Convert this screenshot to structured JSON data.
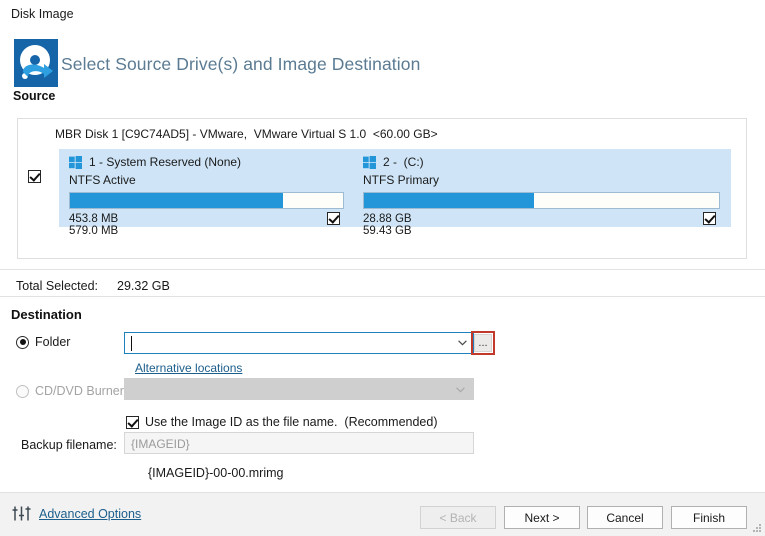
{
  "window": {
    "title": "Disk Image"
  },
  "header": {
    "title": "Select Source Drive(s) and Image Destination",
    "source_label": "Source",
    "icon": "hard-disk-backup-icon"
  },
  "source": {
    "disk_title": "MBR Disk 1 [C9C74AD5] - VMware,  VMware Virtual S 1.0  <60.00 GB>",
    "disk_selected": true,
    "partitions": [
      {
        "icon": "windows-logo-icon",
        "name": "1 - System Reserved (None)",
        "filesystem": "NTFS Active",
        "used": "453.8 MB",
        "total": "579.0 MB",
        "fill_percent": 78,
        "selected": true
      },
      {
        "icon": "windows-logo-icon",
        "name": "2 -  (C:)",
        "filesystem": "NTFS Primary",
        "used": "28.88 GB",
        "total": "59.43 GB",
        "fill_percent": 48,
        "selected": true
      }
    ],
    "total_selected_label": "Total Selected:",
    "total_selected_value": "29.32 GB"
  },
  "destination": {
    "heading": "Destination",
    "folder_radio_label": "Folder",
    "folder_selected": true,
    "folder_value": "",
    "browse_button_label": "...",
    "browse_highlight_color": "#c0392b",
    "alternative_locations_label": "Alternative locations",
    "cddvd_radio_label": "CD/DVD Burner",
    "cddvd_selected": false,
    "cddvd_value": "",
    "use_image_id_label": "Use the Image ID as the file name.  (Recommended)",
    "use_image_id_checked": true,
    "backup_filename_label": "Backup filename:",
    "backup_filename_value": "{IMAGEID}",
    "filename_preview": "{IMAGEID}-00-00.mrimg"
  },
  "footer": {
    "advanced_options_label": "Advanced Options",
    "advanced_options_icon": "sliders-icon",
    "buttons": [
      {
        "label": "< Back",
        "disabled": true
      },
      {
        "label": "Next >",
        "disabled": false
      },
      {
        "label": "Cancel",
        "disabled": false
      },
      {
        "label": "Finish",
        "disabled": false
      }
    ]
  },
  "colors": {
    "accent_blue": "#2296d9",
    "panel_blue": "#cfe5f7",
    "link_blue": "#1c5e8c",
    "header_title": "#5b7b93",
    "highlight_red": "#c0392b"
  }
}
